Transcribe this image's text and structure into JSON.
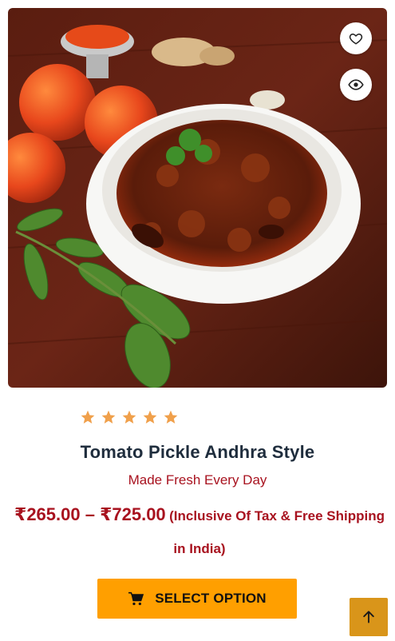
{
  "product": {
    "image_alt": "Tomato pickle in a white bowl with tomatoes, curry leaves and spices",
    "title": "Tomato Pickle Andhra Style",
    "subtitle": "Made Fresh Every Day",
    "rating": 5,
    "rating_max": 5,
    "price_range": "₹265.00 – ₹725.00",
    "price_note": "(Inclusive Of Tax & Free Shipping in India)"
  },
  "actions": {
    "select_option_label": "SELECT OPTION",
    "wishlist_icon": "heart-icon",
    "quick_view_icon": "eye-icon",
    "cart_icon": "cart-icon",
    "scroll_top_icon": "arrow-up-icon"
  },
  "colors": {
    "accent_red": "#a8121f",
    "button_orange": "#ff9f00",
    "star_orange": "#f0a04b",
    "scroll_top_bg": "#d9951a",
    "title_dark": "#1f2d3d"
  }
}
